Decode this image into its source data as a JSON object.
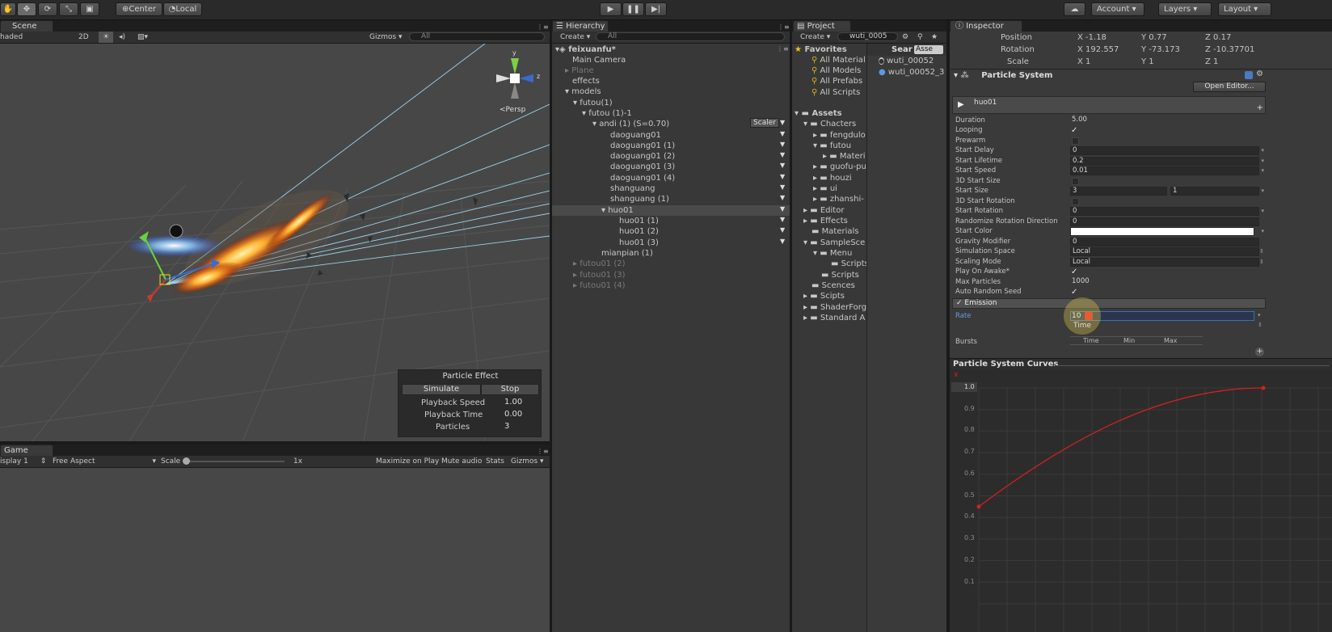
{
  "toolbar": {
    "center": "Center",
    "local": "Local",
    "account": "Account",
    "layers": "Layers",
    "layout": "Layout"
  },
  "scene": {
    "tab": "Scene",
    "shading": "haded",
    "mode2d": "2D",
    "gizmos": "Gizmos",
    "search_placeholder": "All",
    "persp": "Persp",
    "axis_y": "y",
    "axis_z": "z"
  },
  "particle_effect": {
    "title": "Particle Effect",
    "simulate": "Simulate",
    "stop": "Stop",
    "speed_label": "Playback Speed",
    "speed": "1.00",
    "time_label": "Playback Time",
    "time": "0.00",
    "particles_label": "Particles",
    "particles": "3"
  },
  "game": {
    "tab": "Game",
    "display": "isplay 1",
    "aspect": "Free Aspect",
    "scale_label": "Scale",
    "scale_value": "1x",
    "maximize": "Maximize on Play",
    "mute": "Mute audio",
    "stats": "Stats",
    "gizmos": "Gizmos"
  },
  "hierarchy": {
    "tab": "Hierarchy",
    "create": "Create",
    "search_placeholder": "All",
    "scene_name": "feixuanfu*",
    "scaler": "Scaler",
    "items": [
      {
        "label": "Main Camera",
        "gray": false
      },
      {
        "label": "Plane",
        "gray": true
      },
      {
        "label": "effects",
        "gray": false
      },
      {
        "label": "models",
        "gray": false
      },
      {
        "label": "futou(1)",
        "gray": false
      },
      {
        "label": "futou (1)-1",
        "gray": false
      },
      {
        "label": "andi (1) (S=0.70)",
        "gray": false
      },
      {
        "label": "daoguang01",
        "gray": false
      },
      {
        "label": "daoguang01 (1)",
        "gray": false
      },
      {
        "label": "daoguang01 (2)",
        "gray": false
      },
      {
        "label": "daoguang01 (3)",
        "gray": false
      },
      {
        "label": "daoguang01 (4)",
        "gray": false
      },
      {
        "label": "shanguang",
        "gray": false
      },
      {
        "label": "shanguang (1)",
        "gray": false
      },
      {
        "label": "huo01",
        "gray": false
      },
      {
        "label": "huo01 (1)",
        "gray": false
      },
      {
        "label": "huo01 (2)",
        "gray": false
      },
      {
        "label": "huo01 (3)",
        "gray": false
      },
      {
        "label": "mianpian (1)",
        "gray": false
      },
      {
        "label": "futou01 (2)",
        "gray": true
      },
      {
        "label": "futou01 (3)",
        "gray": true
      },
      {
        "label": "futou01 (4)",
        "gray": true
      }
    ]
  },
  "project": {
    "tab": "Project",
    "create": "Create",
    "search_value": "wuti_0005",
    "search_header": "Sear",
    "assets_tab": "Asse",
    "favorites_label": "Favorites",
    "favorites": [
      "All Material",
      "All Models",
      "All Prefabs",
      "All Scripts"
    ],
    "assets_label": "Assets",
    "folders": [
      "Chacters",
      "fengdulo",
      "futou",
      "Materi",
      "guofu-pu",
      "houzi",
      "ui",
      "zhanshi-",
      "Editor",
      "Effects",
      "Materials",
      "SampleSce",
      "Menu",
      "Scripts",
      "Scripts",
      "Scences",
      "Scipts",
      "ShaderForg",
      "Standard A"
    ],
    "results": [
      "wuti_00052",
      "wuti_00052_3"
    ]
  },
  "inspector": {
    "tab": "Inspector",
    "position": {
      "label": "Position",
      "x": "-1.18",
      "y": "0.77",
      "z": "0.17"
    },
    "rotation": {
      "label": "Rotation",
      "x": "192.557",
      "y": "-73.173",
      "z": "-10.37701"
    },
    "scale": {
      "label": "Scale",
      "x": "1",
      "y": "1",
      "z": "1"
    },
    "x": "X",
    "y": "Y",
    "z": "Z",
    "component": "Particle System",
    "open_editor": "Open Editor...",
    "system_name": "huo01",
    "props": [
      {
        "label": "Duration",
        "value": "5.00"
      },
      {
        "label": "Looping",
        "value": "",
        "check": true
      },
      {
        "label": "Prewarm",
        "value": "",
        "check": false
      },
      {
        "label": "Start Delay",
        "value": "0"
      },
      {
        "label": "Start Lifetime",
        "value": "0.2"
      },
      {
        "label": "Start Speed",
        "value": "0.01"
      },
      {
        "label": "3D Start Size",
        "value": "",
        "check": false
      },
      {
        "label": "Start Size",
        "value": "3",
        "value2": "1"
      },
      {
        "label": "3D Start Rotation",
        "value": "",
        "check": false
      },
      {
        "label": "Start Rotation",
        "value": "0"
      },
      {
        "label": "Randomize Rotation Direction",
        "value": "0"
      },
      {
        "label": "Start Color",
        "value": "",
        "color": "#ffffff"
      },
      {
        "label": "Gravity Modifier",
        "value": "0"
      },
      {
        "label": "Simulation Space",
        "value": "Local"
      },
      {
        "label": "Scaling Mode",
        "value": "Local"
      },
      {
        "label": "Play On Awake*",
        "value": "",
        "check": true
      },
      {
        "label": "Max Particles",
        "value": "1000"
      },
      {
        "label": "Auto Random Seed",
        "value": "",
        "check": true
      }
    ],
    "emission": "Emission",
    "rate_label": "Rate",
    "rate_value": "10",
    "rate_mode": "Time",
    "bursts_label": "Bursts",
    "bursts_cols": [
      "Time",
      "Min",
      "Max"
    ]
  },
  "curves": {
    "title": "Particle System Curves",
    "close": "x",
    "y_labels": [
      "1.0",
      "0.9",
      "0.8",
      "0.7",
      "0.6",
      "0.5",
      "0.4",
      "0.3",
      "0.2",
      "0.1"
    ],
    "curve_start": 0.45,
    "curve_end": 1.0
  },
  "colors": {
    "curve": "#d42020",
    "accent": "#3e6fb0",
    "selection": "#3d3d3d"
  }
}
